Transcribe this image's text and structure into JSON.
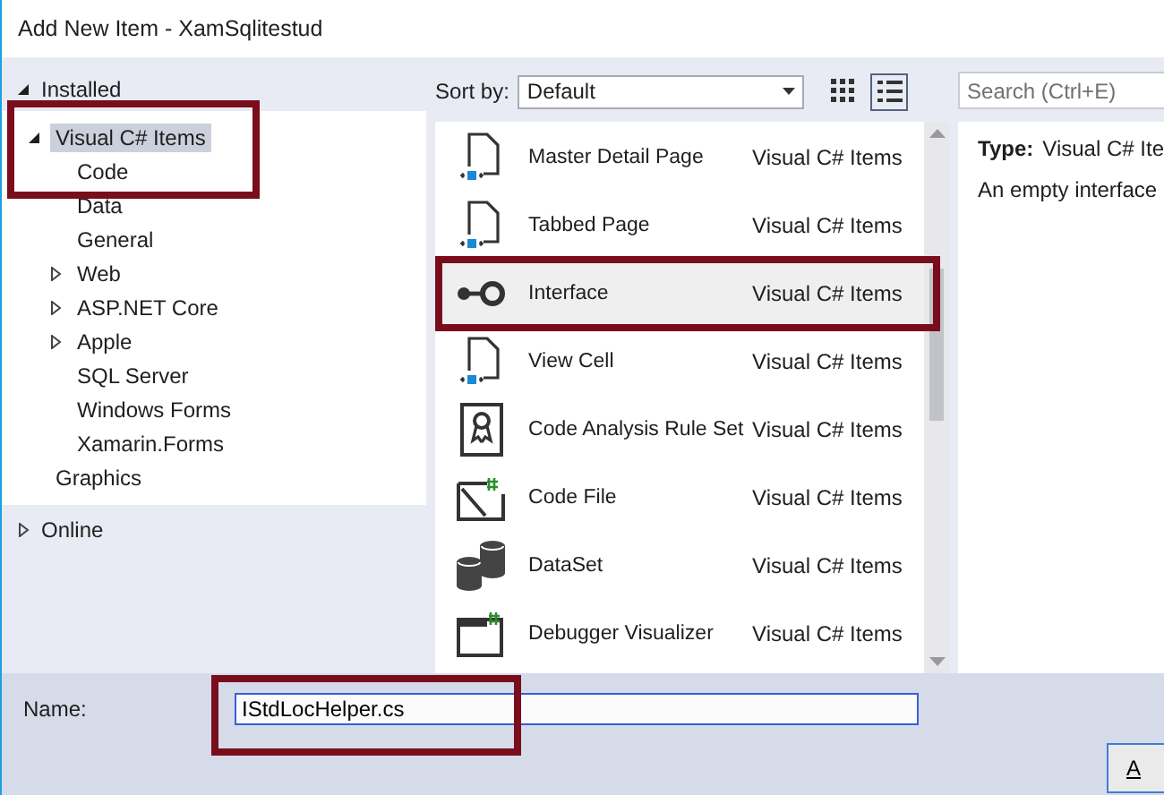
{
  "window": {
    "title": "Add New Item - XamSqlitestud"
  },
  "sidebar": {
    "sections": [
      {
        "label": "Installed",
        "expanded": true,
        "children": [
          {
            "label": "Visual C# Items",
            "expanded": true,
            "selected": true,
            "highlighted": true,
            "children": [
              {
                "label": "Code",
                "selected": false
              },
              {
                "label": "Data",
                "selected": false
              },
              {
                "label": "General",
                "selected": false
              },
              {
                "label": "Web",
                "expanded": false,
                "selected": false
              },
              {
                "label": "ASP.NET Core",
                "expanded": false,
                "selected": false
              },
              {
                "label": "Apple",
                "expanded": false,
                "selected": false
              },
              {
                "label": "SQL Server",
                "selected": false
              },
              {
                "label": "Windows Forms",
                "selected": false
              },
              {
                "label": "Xamarin.Forms",
                "selected": false
              }
            ]
          },
          {
            "label": "Graphics",
            "selected": false
          }
        ]
      },
      {
        "label": "Online",
        "expanded": false
      }
    ]
  },
  "toolbar": {
    "sort_label": "Sort by:",
    "sort_value": "Default",
    "views": [
      {
        "kind": "grid",
        "selected": false
      },
      {
        "kind": "list",
        "selected": true
      }
    ],
    "search": {
      "placeholder": "Search (Ctrl+E)"
    }
  },
  "templates": [
    {
      "kind": "page",
      "name": "Master Detail Page",
      "category": "Visual C# Items",
      "selected": false,
      "highlighted": false
    },
    {
      "kind": "page",
      "name": "Tabbed Page",
      "category": "Visual C# Items",
      "selected": false,
      "highlighted": false
    },
    {
      "kind": "interface",
      "name": "Interface",
      "category": "Visual C# Items",
      "selected": true,
      "highlighted": true
    },
    {
      "kind": "page",
      "name": "View Cell",
      "category": "Visual C# Items",
      "selected": false,
      "highlighted": false
    },
    {
      "kind": "ruleset",
      "name": "Code Analysis Rule Set",
      "category": "Visual C# Items",
      "selected": false,
      "highlighted": false
    },
    {
      "kind": "codefile",
      "name": "Code File",
      "category": "Visual C# Items",
      "selected": false,
      "highlighted": false
    },
    {
      "kind": "dataset",
      "name": "DataSet",
      "category": "Visual C# Items",
      "selected": false,
      "highlighted": false
    },
    {
      "kind": "window",
      "name": "Debugger Visualizer",
      "category": "Visual C# Items",
      "selected": false,
      "highlighted": false
    }
  ],
  "details": {
    "type_label": "Type:",
    "type_value": "Visual C# Ite",
    "description": "An empty interface"
  },
  "name_field": {
    "label": "Name:",
    "value": "IStdLocHelper.cs",
    "highlighted": true
  },
  "buttons": [
    "A"
  ]
}
